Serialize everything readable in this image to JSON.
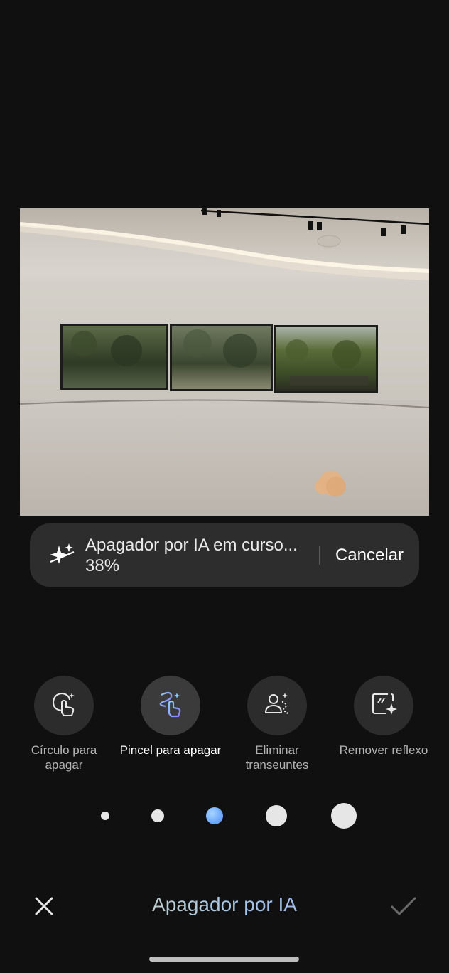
{
  "photo": {
    "description_icon": "gallery-photo"
  },
  "toast": {
    "icon": "ai-sparkle-icon",
    "status_text": "Apagador por IA em curso... 38%",
    "progress_percent": 38,
    "cancel_label": "Cancelar"
  },
  "tools": [
    {
      "label": "Círculo para apagar",
      "icon": "circle-erase-icon"
    },
    {
      "label": "Pincel para apagar",
      "icon": "brush-erase-icon",
      "active": true
    },
    {
      "label": "Eliminar transeuntes",
      "icon": "remove-people-icon"
    },
    {
      "label": "Remover reflexo",
      "icon": "remove-reflection-icon"
    }
  ],
  "brush_sizes": {
    "count": 5,
    "selected_index": 2
  },
  "bottom_bar": {
    "title": "Apagador por IA",
    "close_icon": "close-icon",
    "done_icon": "check-icon"
  },
  "colors": {
    "background": "#101010",
    "toast_bg": "#2d2d2d",
    "tool_bg": "#2c2c2c",
    "accent_blue": "#6aa8ff",
    "brush_mark": "#e3b284"
  }
}
